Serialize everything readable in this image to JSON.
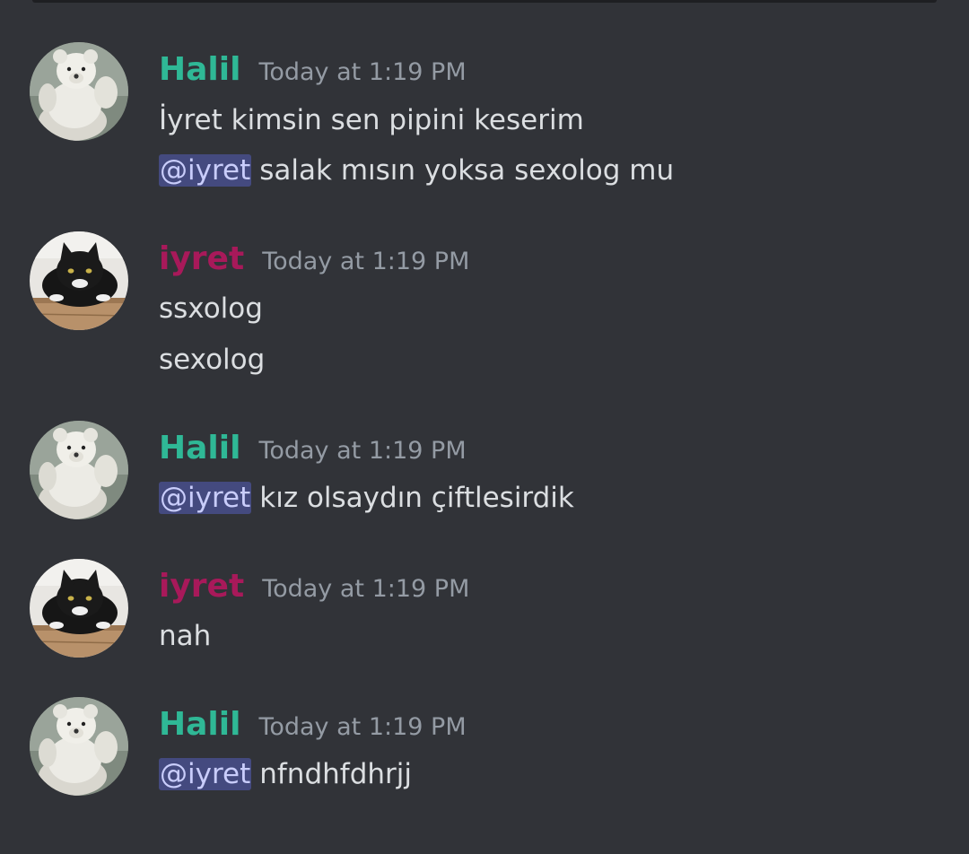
{
  "colors": {
    "background": "#313338",
    "halil_name": "#2fb896",
    "iyret_name": "#a8195a",
    "timestamp": "#949ba4",
    "text": "#dbdee1",
    "mention_bg": "#444a7f",
    "mention_text": "#c9cdfb"
  },
  "messages": [
    {
      "author": "Halil",
      "avatar": "teddy-bear-avatar",
      "timestamp": "Today at 1:19 PM",
      "lines": [
        {
          "mention": "",
          "text": "İyret kimsin sen pipini keserim"
        },
        {
          "mention": "@iyret",
          "text": "salak mısın yoksa sexolog mu"
        }
      ]
    },
    {
      "author": "iyret",
      "avatar": "black-cat-avatar",
      "timestamp": "Today at 1:19 PM",
      "lines": [
        {
          "mention": "",
          "text": "ssxolog"
        },
        {
          "mention": "",
          "text": "sexolog"
        }
      ]
    },
    {
      "author": "Halil",
      "avatar": "teddy-bear-avatar",
      "timestamp": "Today at 1:19 PM",
      "lines": [
        {
          "mention": "@iyret",
          "text": "kız olsaydın çiftlesirdik"
        }
      ]
    },
    {
      "author": "iyret",
      "avatar": "black-cat-avatar",
      "timestamp": "Today at 1:19 PM",
      "lines": [
        {
          "mention": "",
          "text": "nah"
        }
      ]
    },
    {
      "author": "Halil",
      "avatar": "teddy-bear-avatar",
      "timestamp": "Today at 1:19 PM",
      "lines": [
        {
          "mention": "@iyret",
          "text": "nfndhfdhrjj"
        }
      ]
    }
  ]
}
